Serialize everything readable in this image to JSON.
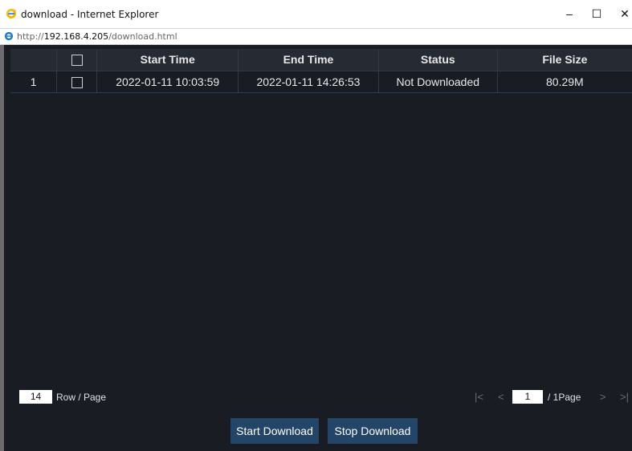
{
  "window": {
    "title": "download - Internet Explorer",
    "url_prefix": "http://",
    "url_host": "192.168.4.205",
    "url_path": "/download.html",
    "minimize": "–",
    "maximize": "☐",
    "close": "✕"
  },
  "table": {
    "headers": {
      "index": "",
      "start_time": "Start Time",
      "end_time": "End Time",
      "status": "Status",
      "file_size": "File Size"
    },
    "rows": [
      {
        "index": "1",
        "start_time": "2022-01-11 10:03:59",
        "end_time": "2022-01-11 14:26:53",
        "status": "Not Downloaded",
        "file_size": "80.29M"
      }
    ]
  },
  "footer": {
    "rows_per_page": "14",
    "rows_label": "Row / Page",
    "page_input": "1",
    "page_total": "/ 1Page",
    "first_icon": "|<",
    "prev_icon": "<",
    "next_icon": ">",
    "last_icon": ">|"
  },
  "buttons": {
    "start": "Start Download",
    "stop": "Stop Download"
  },
  "colors": {
    "background": "#1a1c24",
    "header_bg": "#262a33",
    "button_bg": "#234567"
  }
}
